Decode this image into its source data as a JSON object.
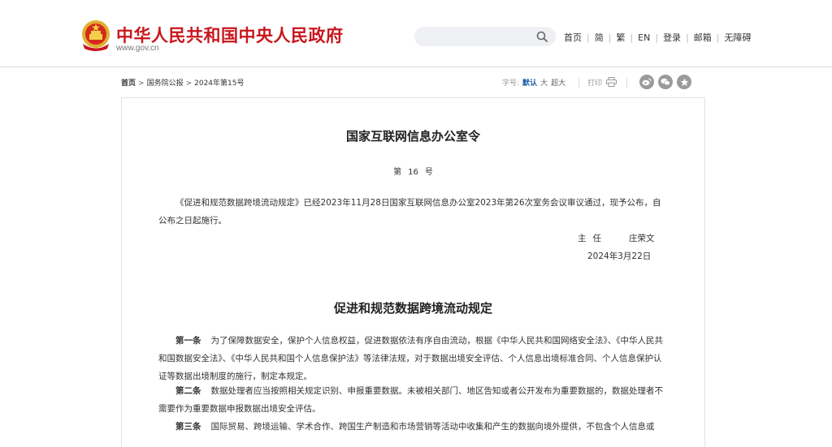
{
  "header": {
    "site_title": "中华人民共和国中央人民政府",
    "site_domain": "www.gov.cn",
    "search": {
      "placeholder": ""
    },
    "nav": [
      "首页",
      "简",
      "繁",
      "EN",
      "登录",
      "邮箱",
      "无障碍"
    ]
  },
  "breadcrumb": [
    "首页",
    "国务院公报",
    "2024年第15号"
  ],
  "tools": {
    "font_size_label": "字号:",
    "font_sizes": [
      "默认",
      "大",
      "超大"
    ],
    "print_label": "打印"
  },
  "colors": {
    "brand_red": "#c8161d",
    "active_blue": "#1a5aa8"
  },
  "icons": [
    "emblem-icon",
    "search-icon",
    "print-icon",
    "weibo-icon",
    "wechat-icon",
    "favorite-icon"
  ],
  "article": {
    "order_title": "国家互联网信息办公室令",
    "order_number": [
      "第",
      "16",
      "号"
    ],
    "preamble": "《促进和规范数据跨境流动规定》已经2023年11月28日国家互联网信息办公室2023年第26次室务会议审议通过，现予公布，自公布之日起施行。",
    "signer_role": "主任",
    "signer_name": "庄荣文",
    "date": "2024年3月22日",
    "reg_title": "促进和规范数据跨境流动规定",
    "articles": [
      {
        "no": "第一条",
        "text": "为了保障数据安全，保护个人信息权益，促进数据依法有序自由流动，根据《中华人民共和国网络安全法》、《中华人民共和国数据安全法》、《中华人民共和国个人信息保护法》等法律法规，对于数据出境安全评估、个人信息出境标准合同、个人信息保护认证等数据出境制度的施行，制定本规定。"
      },
      {
        "no": "第二条",
        "text": "数据处理者应当按照相关规定识别、申报重要数据。未被相关部门、地区告知或者公开发布为重要数据的，数据处理者不需要作为重要数据申报数据出境安全评估。"
      },
      {
        "no": "第三条",
        "text": "国际贸易、跨境运输、学术合作、跨国生产制造和市场营销等活动中收集和产生的数据向境外提供，不包含个人信息或"
      }
    ]
  }
}
